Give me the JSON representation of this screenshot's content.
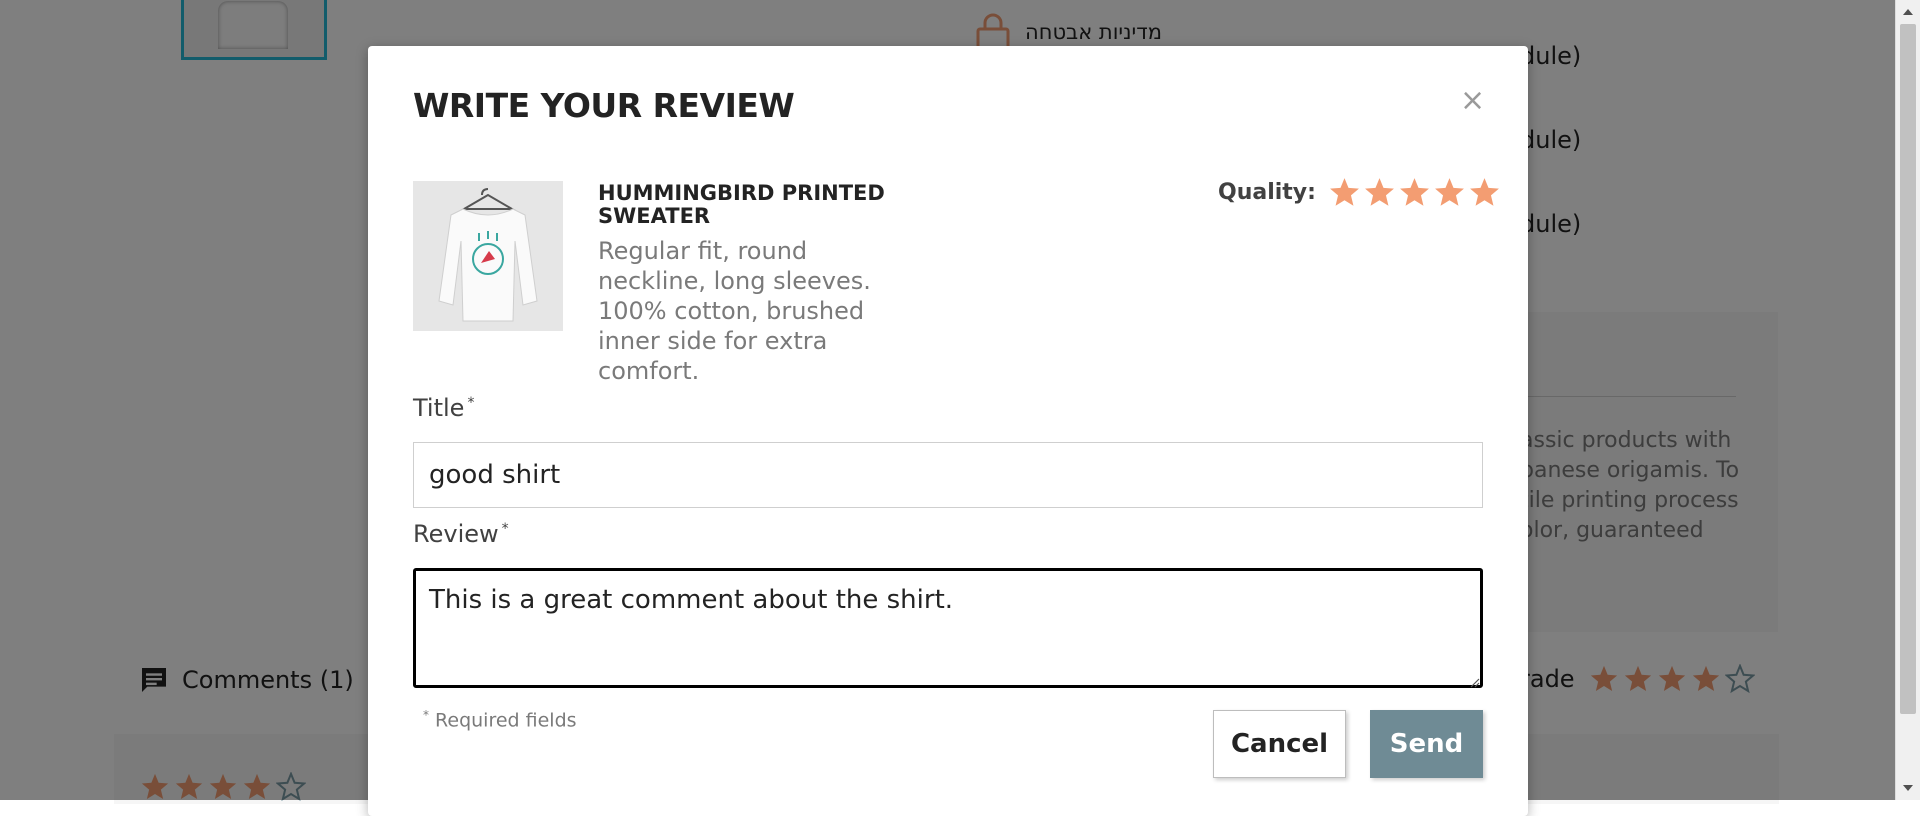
{
  "background": {
    "reassurance_text": "מדיניות אבטחה",
    "cut_texts": [
      "dule)",
      "dule)",
      "dule)"
    ],
    "card_paragraph": "assic products with panese origamis. To tile printing process olor, guaranteed",
    "comments_label": "Comments (1)",
    "grade_label": "rade",
    "grade_stars": 4,
    "grade_stars_total": 5,
    "bottom_stars": 4,
    "colors": {
      "star": "#f39d72",
      "accent_border": "#24b9d7"
    }
  },
  "modal": {
    "title": "WRITE YOUR REVIEW",
    "close_glyph": "×",
    "product": {
      "name": "HUMMINGBIRD PRINTED SWEATER",
      "description": "Regular fit, round neckline, long sleeves. 100% cotton, brushed inner side for extra comfort."
    },
    "quality": {
      "label": "Quality:",
      "rating": 5,
      "max": 5
    },
    "title_field": {
      "label": "Title",
      "required_mark": "*",
      "value": "good shirt"
    },
    "review_field": {
      "label": "Review",
      "required_mark": "*",
      "value": "This is a great comment about the shirt."
    },
    "required_note": {
      "mark": "*",
      "text": "Required fields"
    },
    "cancel_label": "Cancel",
    "send_label": "Send",
    "colors": {
      "send_bg": "#6f8b95",
      "star": "#f39d72"
    }
  }
}
